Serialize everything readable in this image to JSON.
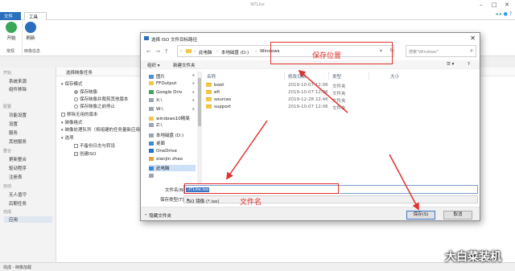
{
  "app": {
    "title": "NTLite"
  },
  "tabs": {
    "file": "文件",
    "tools": "工具栏"
  },
  "ribbon": {
    "start": "开始",
    "refresh": "刷新",
    "group_common": "常规",
    "group_image_info": "映像信息"
  },
  "sidebar": {
    "sections": [
      {
        "head": "开始",
        "items": [
          "系统来源",
          "组件移除"
        ]
      },
      {
        "head": "配置",
        "items": [
          "功能设置",
          "设置",
          "服务",
          "其他服务"
        ]
      },
      {
        "head": "整合",
        "items": [
          "更新整合",
          "驱动程序",
          "注册表"
        ]
      },
      {
        "head": "自动",
        "items": [
          "无人值守",
          "后期任务"
        ]
      },
      {
        "head": "完成",
        "items": [
          "应用"
        ]
      }
    ]
  },
  "content": {
    "header": "选择映像任务",
    "items": [
      {
        "kind": "tri",
        "label": "保存模式"
      },
      {
        "kind": "radio",
        "on": true,
        "label": "保存映像"
      },
      {
        "kind": "radio",
        "on": false,
        "label": "保存映像并裁剪其他版本"
      },
      {
        "kind": "radio",
        "on": false,
        "label": "保存映像之前停止"
      },
      {
        "kind": "cb",
        "on": false,
        "label": "移除无用的版本"
      },
      {
        "kind": "tri",
        "label": "映像格式"
      },
      {
        "kind": "tri",
        "label": "映像处理队列（将组建的任务量新应用）"
      },
      {
        "kind": "tri",
        "label": "选项"
      },
      {
        "kind": "cb",
        "on": false,
        "label": "不备份日志与转设"
      },
      {
        "kind": "cb",
        "on": true,
        "label": "创建ISO"
      }
    ]
  },
  "statusbar": {
    "text": "完成 - 映像加载"
  },
  "dialog": {
    "title": "选择 ISO 文件目标路径",
    "close": "✕",
    "breadcrumb": [
      "此电脑",
      "本地磁盘 (D:)",
      "Windows"
    ],
    "search_placeholder": "搜索\"Windows\"",
    "toolbar": {
      "organize": "组织 ▾",
      "new_folder": "新建文件夹"
    },
    "nav": [
      {
        "label": "图片",
        "icon": "pictures-icon",
        "color": "#4a90d9",
        "pinned": true
      },
      {
        "label": "FFOutput",
        "icon": "folder-icon",
        "color": "#f4c74b",
        "pinned": true
      },
      {
        "label": "Google Driv",
        "icon": "google-drive-icon",
        "color": "#3aa757",
        "pinned": true
      },
      {
        "label": "X:\\",
        "icon": "drive-icon",
        "color": "#9aa5b1",
        "pinned": true
      },
      {
        "label": "W:\\",
        "icon": "drive-icon",
        "color": "#9aa5b1",
        "pinned": true
      },
      {
        "label": "windows10精简",
        "icon": "folder-icon",
        "color": "#f4c74b",
        "pinned": false
      },
      {
        "label": "Z:\\",
        "icon": "drive-icon",
        "color": "#9aa5b1",
        "pinned": false
      },
      {
        "label": "本地磁盘 (D:)",
        "icon": "drive-icon",
        "color": "#9aa5b1",
        "pinned": false
      },
      {
        "label": "桌面",
        "icon": "desktop-icon",
        "color": "#3b8ad8",
        "pinned": false
      },
      {
        "label": "OneDrive",
        "icon": "onedrive-icon",
        "color": "#1f73d0",
        "pinned": false
      },
      {
        "label": "xianjin zhao",
        "icon": "user-icon",
        "color": "#e2a33c",
        "pinned": false
      },
      {
        "label": "此电脑",
        "icon": "computer-icon",
        "color": "#3b8ad8",
        "pinned": false,
        "selected": true
      },
      {
        "label": "",
        "icon": "library-icon",
        "color": "#9aa5b1",
        "pinned": false
      }
    ],
    "columns": {
      "name": "名称",
      "date": "修改日期",
      "type": "类型",
      "size": "大小"
    },
    "files": [
      {
        "name": "boot",
        "date": "2019-10-07 12:06",
        "type": "文件夹"
      },
      {
        "name": "efi",
        "date": "2019-10-07 12:06",
        "type": "文件夹"
      },
      {
        "name": "sources",
        "date": "2019-12-28 22:46",
        "type": "文件夹"
      },
      {
        "name": "support",
        "date": "2019-10-07 12:06",
        "type": "文件夹"
      }
    ],
    "filename_label": "文件名(N):",
    "filename_value": "NTLite.iso",
    "filetype_label": "保存类型(T):",
    "filetype_value": "ISO 镜像 (*.iso)",
    "hide_folders": "隐藏文件夹",
    "save": "保存(S)",
    "cancel": "取消"
  },
  "annotations": {
    "save_location": "保存位置",
    "file_name": "文件名",
    "color": "#e0322e"
  },
  "watermark": "大白菜装机"
}
